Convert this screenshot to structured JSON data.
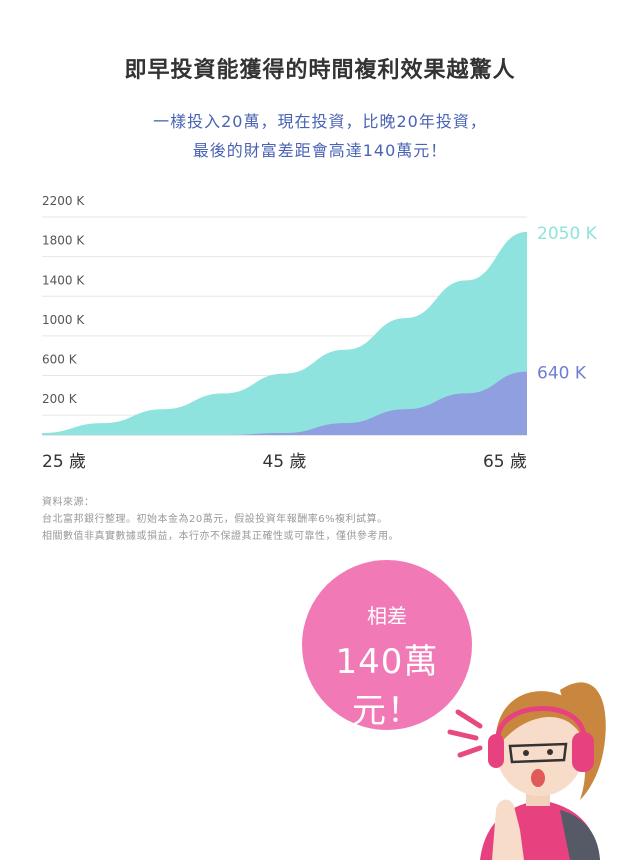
{
  "header": {
    "title": "即早投資能獲得的時間複利效果越驚人",
    "subtitle_line1": "一樣投入20萬，現在投資，比晚20年投資，",
    "subtitle_line2": "最後的財富差距會高達140萬元！"
  },
  "chart_data": {
    "type": "area",
    "x": [
      25,
      30,
      35,
      40,
      45,
      50,
      55,
      60,
      65
    ],
    "series": [
      {
        "values": [
          20,
          120,
          260,
          420,
          620,
          860,
          1180,
          1560,
          2050
        ],
        "color": "#8fe3df"
      },
      {
        "values": [
          0,
          0,
          0,
          0,
          20,
          120,
          260,
          420,
          640
        ],
        "color": "#8f9fdf"
      }
    ],
    "ytick_labels": [
      "2200 K",
      "1800 K",
      "1400 K",
      "1000 K",
      "600 K",
      "200 K"
    ],
    "xtick_labels": [
      "25 歲",
      "45 歲",
      "65 歲"
    ],
    "end_labels": [
      "2050 K",
      "640 K"
    ],
    "ylim": [
      0,
      2200
    ],
    "xlim": [
      25,
      65
    ],
    "grid": true
  },
  "source": {
    "line1": "資料來源：",
    "line2": "台北富邦銀行整理。初始本金為20萬元，假設投資年報酬率6%複利試算。",
    "line3": "相關數值非真實數據或損益，本行亦不保證其正確性或可靠性，僅供參考用。"
  },
  "callout": {
    "line1": "相差",
    "line2": "140萬元！"
  },
  "colors": {
    "accent": "#4a63b4",
    "early_area": "#8fe3df",
    "late_area": "#8f9fdf",
    "early_label": "#8fe3df",
    "late_label": "#6f7fd0",
    "bubble": "#f179b6"
  }
}
